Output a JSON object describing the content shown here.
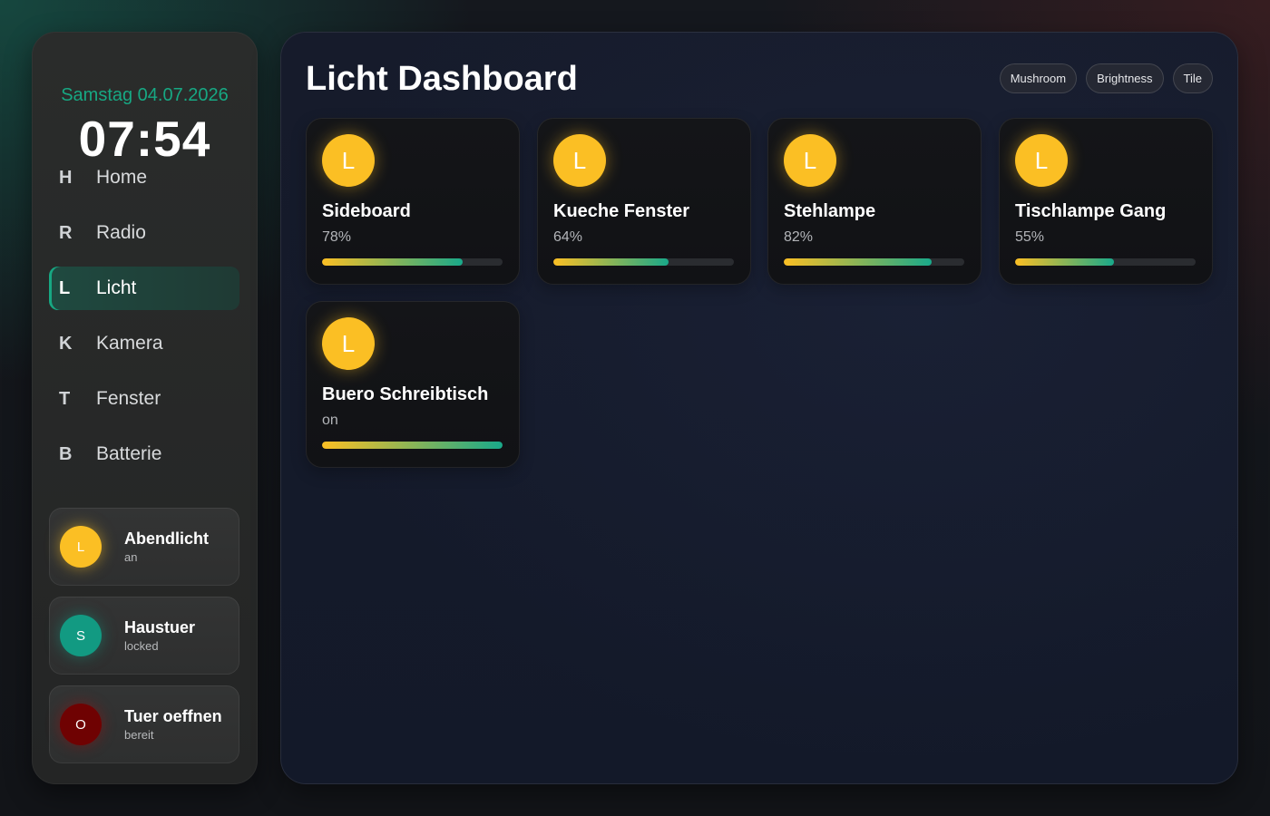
{
  "sidebar": {
    "date": "Samstag 04.07.2026",
    "time": "07:54",
    "nav": [
      {
        "letter": "H",
        "label": "Home",
        "active": false
      },
      {
        "letter": "R",
        "label": "Radio",
        "active": false
      },
      {
        "letter": "L",
        "label": "Licht",
        "active": true
      },
      {
        "letter": "K",
        "label": "Kamera",
        "active": false
      },
      {
        "letter": "T",
        "label": "Fenster",
        "active": false
      },
      {
        "letter": "B",
        "label": "Batterie",
        "active": false
      }
    ],
    "quick": [
      {
        "icon": "L",
        "title": "Abendlicht",
        "status": "an",
        "color": "#fbbf24",
        "icon_name": "light-icon"
      },
      {
        "icon": "S",
        "title": "Haustuer",
        "status": "locked",
        "color": "#129a82",
        "icon_name": "lock-icon"
      },
      {
        "icon": "O",
        "title": "Tuer oeffnen",
        "status": "bereit",
        "color": "#6f0202",
        "icon_name": "door-open-icon"
      }
    ]
  },
  "main": {
    "title": "Licht Dashboard",
    "chips": [
      "Mushroom",
      "Brightness",
      "Tile"
    ],
    "lights": [
      {
        "icon": "L",
        "name": "Sideboard",
        "state": "78%",
        "brightness": 0.78
      },
      {
        "icon": "L",
        "name": "Kueche Fenster",
        "state": "64%",
        "brightness": 0.64
      },
      {
        "icon": "L",
        "name": "Stehlampe",
        "state": "82%",
        "brightness": 0.82
      },
      {
        "icon": "L",
        "name": "Tischlampe Gang",
        "state": "55%",
        "brightness": 0.55
      },
      {
        "icon": "L",
        "name": "Buero Schreibtisch",
        "state": "on",
        "brightness": 1.0
      }
    ]
  },
  "colors": {
    "accent": "#17a883",
    "bulb": "#fbbf24"
  }
}
